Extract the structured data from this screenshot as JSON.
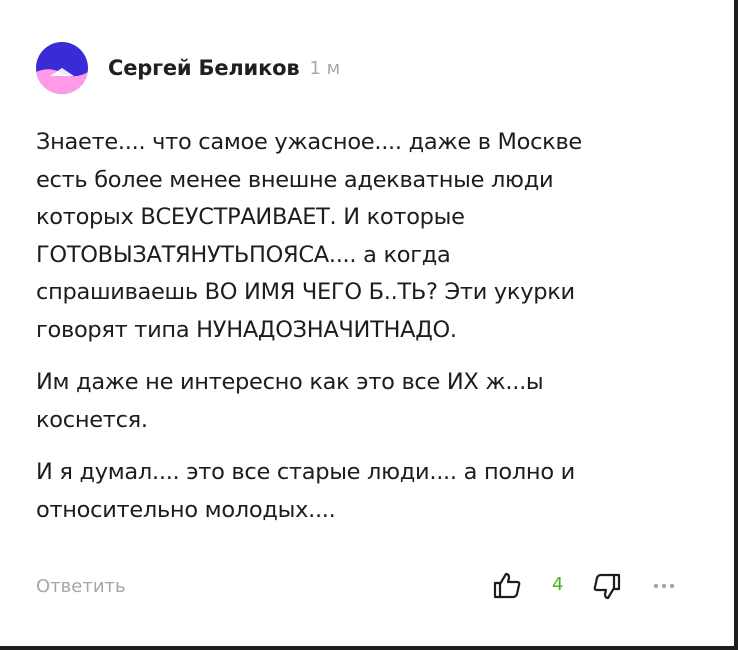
{
  "comment": {
    "author": "Сергей Беликов",
    "time": "1 м",
    "paragraphs": [
      "Знаете.... что самое ужасное.... даже в Москве\nесть более менее внешне адекватные люди\nкоторых ВСЕУСТРАИВАЕТ. И которые\nГОТОВЫЗАТЯНУТЬПОЯСА.... а когда\nспрашиваешь ВО ИМЯ ЧЕГО Б..ТЬ? Эти укурки\nговорят типа НУНАДОЗНАЧИТНАДО.",
      "Им даже не интересно как это все ИХ ж...ы\nкоснется.",
      "И я думал.... это все старые люди.... а полно и\nотносительно молодых...."
    ]
  },
  "actions": {
    "reply_label": "Ответить",
    "like_count": "4"
  },
  "icons": {
    "avatar": "avatar-logo",
    "like": "thumbs-up-icon",
    "dislike": "thumbs-down-icon",
    "more": "more-dots-icon"
  },
  "colors": {
    "avatar_top": "#3b2bd6",
    "avatar_bottom": "#ff9be6",
    "like_count": "#4caf1d",
    "muted_text": "#a6a6a6"
  }
}
